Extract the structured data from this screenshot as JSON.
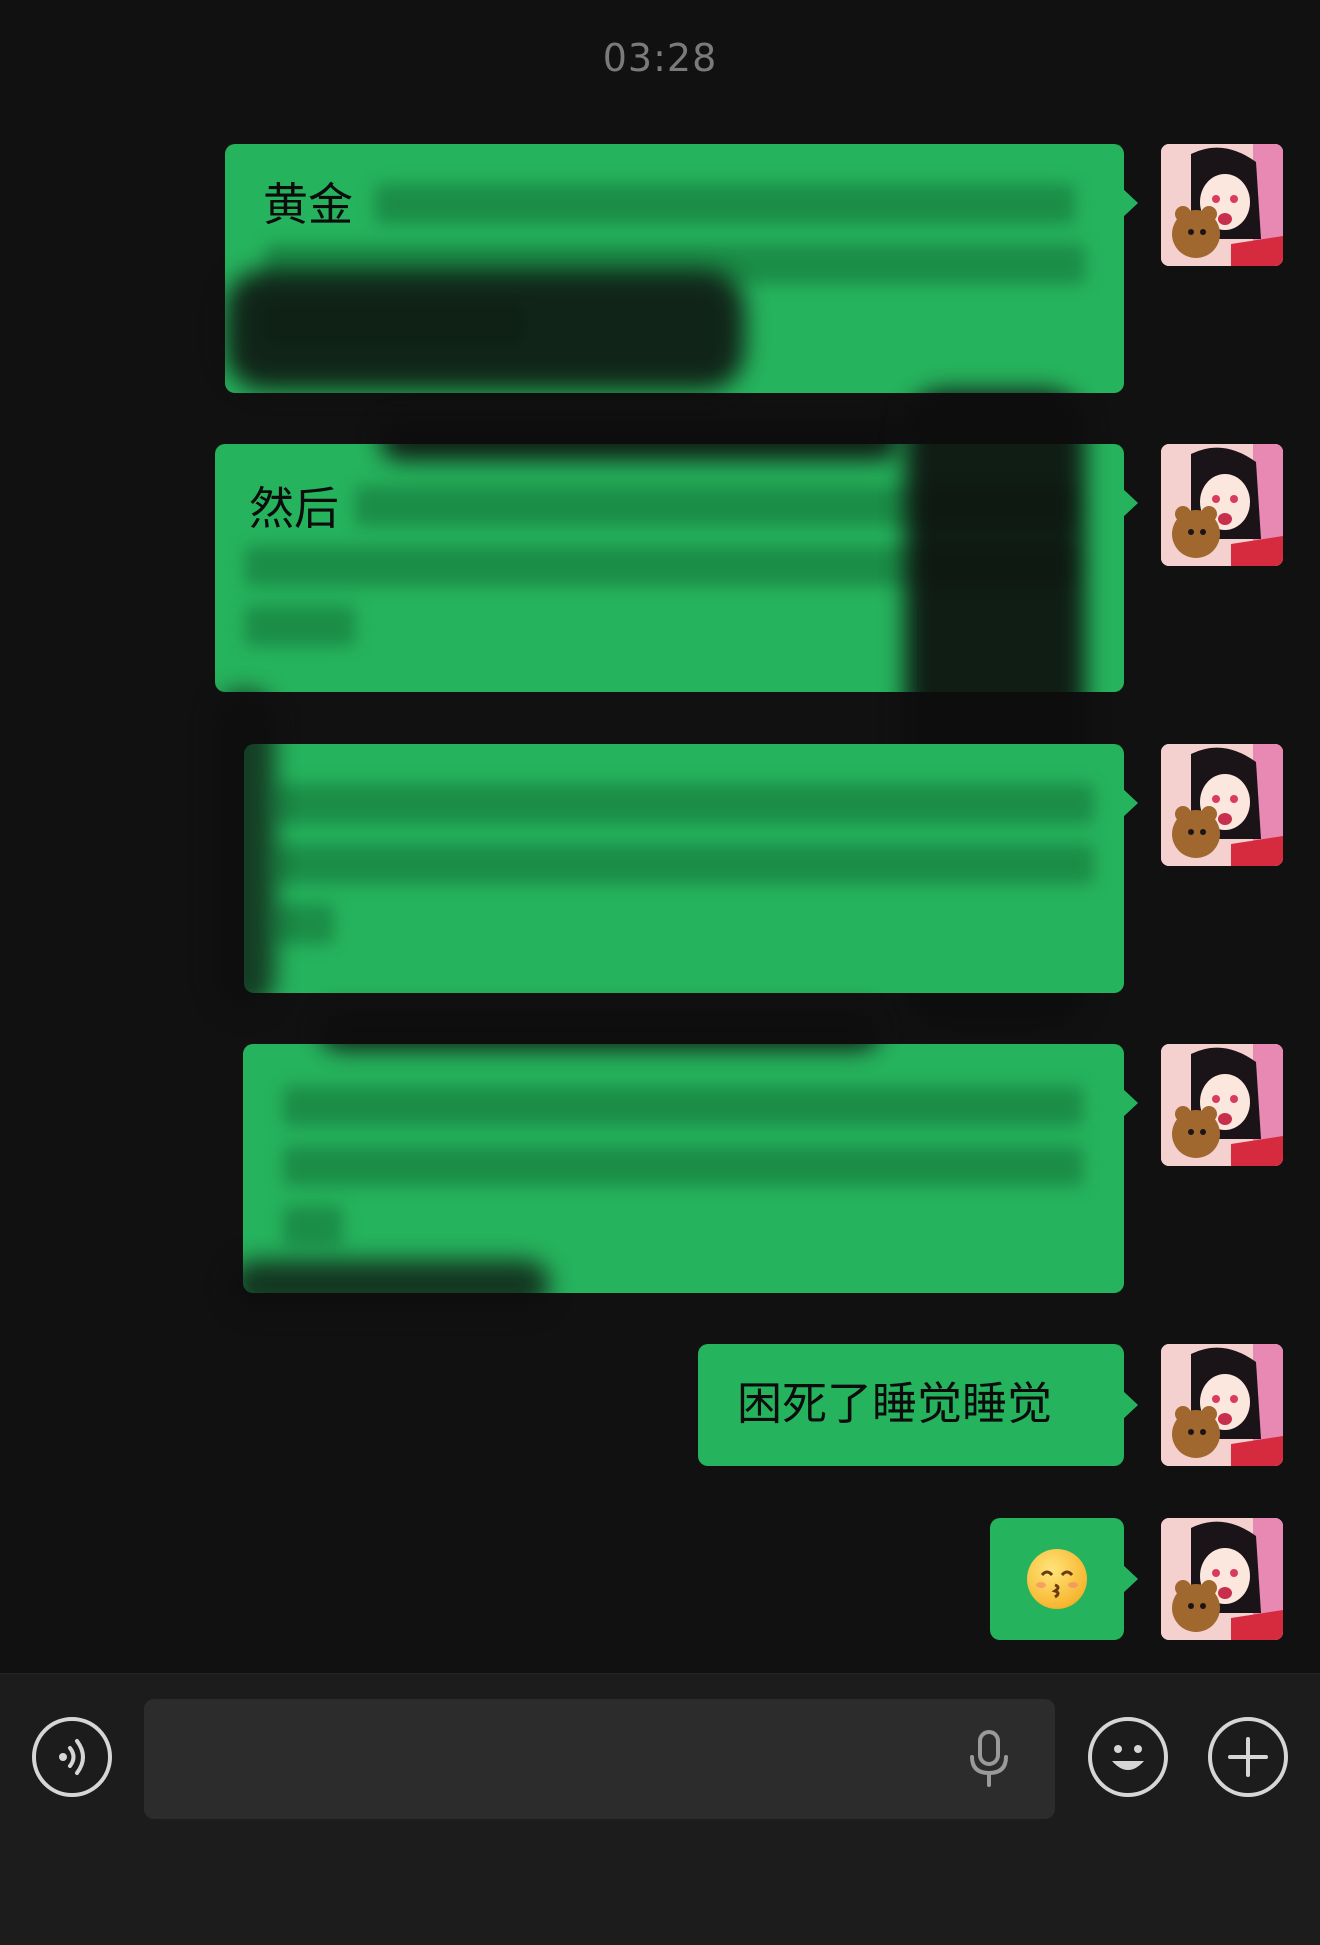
{
  "timestamp": "03:28",
  "messages": [
    {
      "visible_text": "黄金",
      "redacted": true
    },
    {
      "visible_text": "然后",
      "redacted": true
    },
    {
      "visible_text": "",
      "redacted": true
    },
    {
      "visible_text": "",
      "redacted": true
    },
    {
      "visible_text": "困死了睡觉睡觉",
      "redacted": false
    },
    {
      "visible_text": "",
      "redacted": false,
      "emoji": "kissing-face-emoji"
    }
  ],
  "input": {
    "placeholder": "",
    "value": ""
  },
  "icons": {
    "voice": "voice-mode-icon",
    "microphone": "microphone-icon",
    "emoji": "emoji-icon",
    "more": "plus-icon"
  },
  "colors": {
    "background": "#111111",
    "bubble": "#26b35d",
    "input_bar": "#1c1c1c"
  }
}
